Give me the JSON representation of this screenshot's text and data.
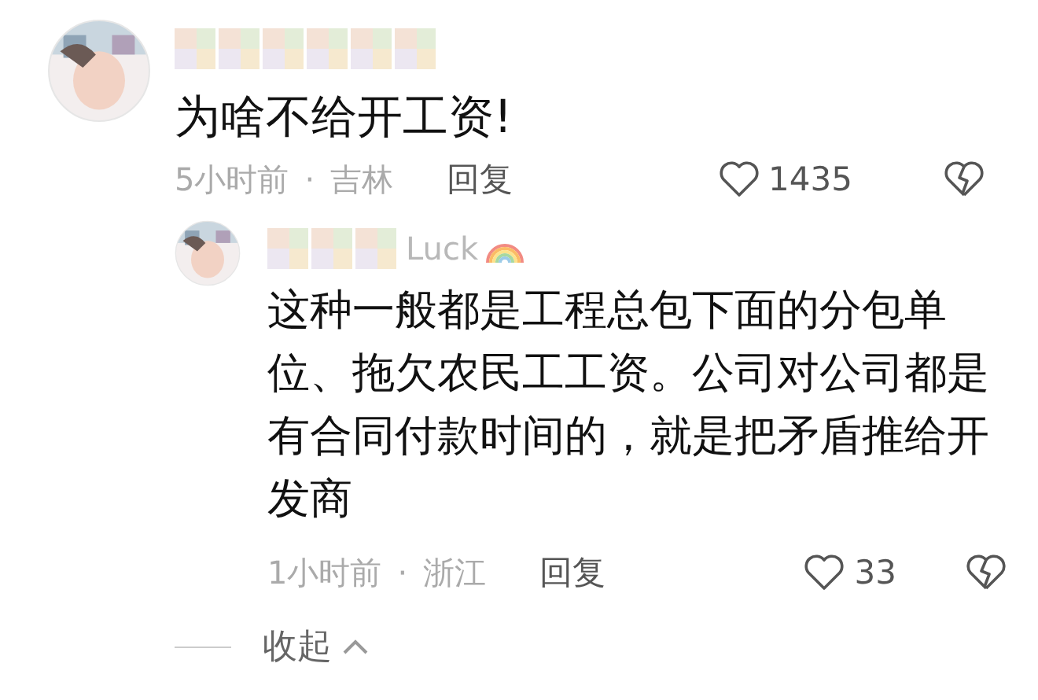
{
  "comments": [
    {
      "body": "为啥不给开工资!",
      "time": "5小时前",
      "separator": "·",
      "location": "吉林",
      "reply": "回复",
      "likes": "1435",
      "children": [
        {
          "username": "Luck",
          "body": "这种一般都是工程总包下面的分包单位、拖欠农民工工资。公司对公司都是有合同付款时间的，就是把矛盾推给开发商",
          "time": "1小时前",
          "separator": "·",
          "location": "浙江",
          "reply": "回复",
          "likes": "33"
        }
      ]
    }
  ],
  "collapse": {
    "label": "收起"
  }
}
